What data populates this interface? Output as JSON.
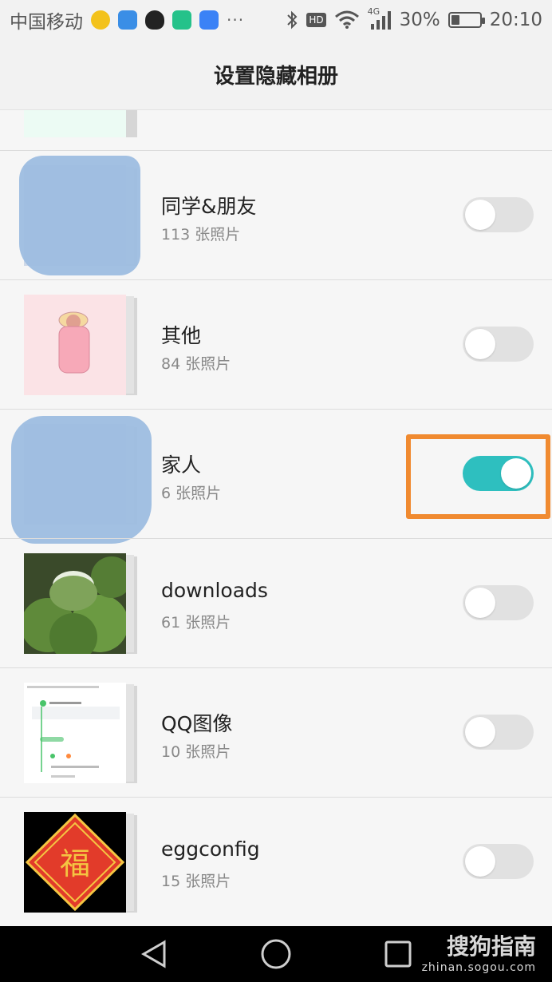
{
  "status_bar": {
    "carrier": "中国移动",
    "more": "···",
    "network_hd": "HD",
    "network_type": "4G",
    "battery": "30%",
    "battery_level": 0.3,
    "time": "20:10"
  },
  "header": {
    "title": "设置隐藏相册"
  },
  "albums": [
    {
      "name": "同学&朋友",
      "count": "113 张照片",
      "hidden": false,
      "thumb": "masked"
    },
    {
      "name": "其他",
      "count": "84 张照片",
      "hidden": false,
      "thumb": "baby-sticker"
    },
    {
      "name": "家人",
      "count": "6 张照片",
      "hidden": true,
      "thumb": "masked"
    },
    {
      "name": "downloads",
      "count": "61 张照片",
      "hidden": false,
      "thumb": "coconuts"
    },
    {
      "name": "QQ图像",
      "count": "10 张照片",
      "hidden": false,
      "thumb": "screenshot"
    },
    {
      "name": "eggconfig",
      "count": "15 张照片",
      "hidden": false,
      "thumb": "fu-character"
    }
  ],
  "fu_glyph": "福",
  "colors": {
    "toggle_on": "#2ebfbf",
    "toggle_off": "#e1e1e1",
    "highlight": "#f08a30"
  },
  "watermark": {
    "name": "搜狗指南",
    "url": "zhinan.sogou.com"
  }
}
